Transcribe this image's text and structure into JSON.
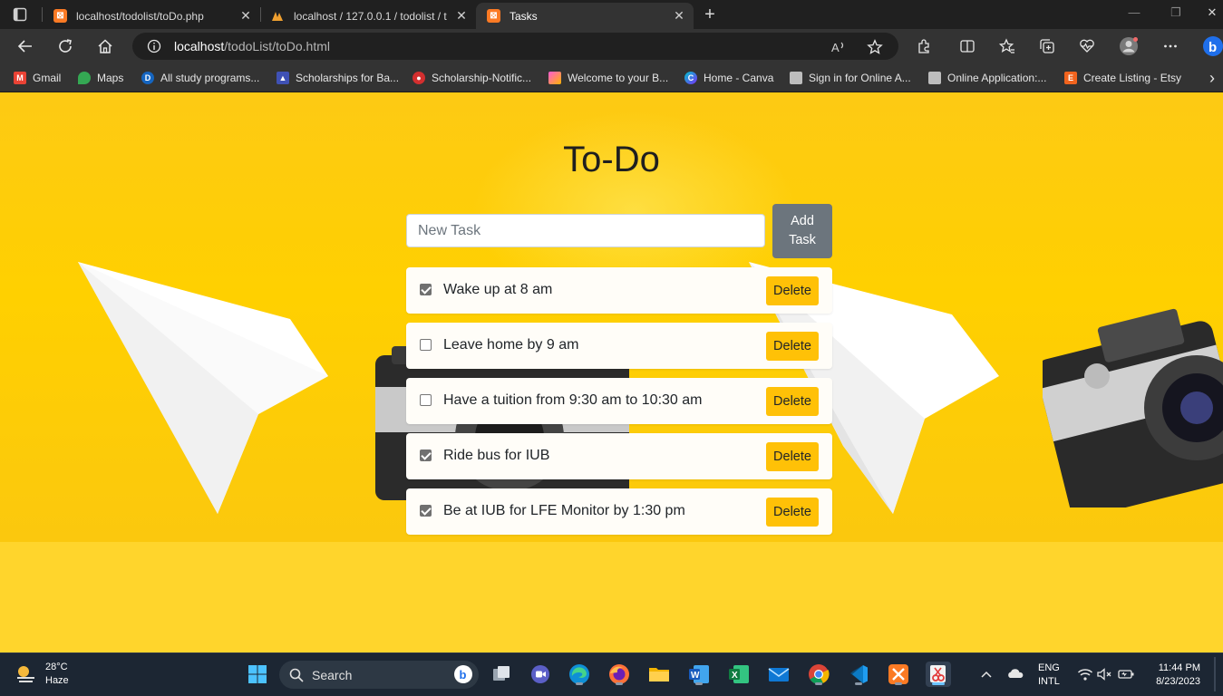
{
  "browser": {
    "tabs": [
      {
        "title": "localhost/todolist/toDo.php",
        "active": false,
        "icon": "xampp-icon"
      },
      {
        "title": "localhost / 127.0.0.1 / todolist / t",
        "active": false,
        "icon": "phpmyadmin-icon"
      },
      {
        "title": "Tasks",
        "active": true,
        "icon": "xampp-icon"
      }
    ],
    "tab_close_glyph": "✕",
    "new_tab_glyph": "+",
    "window_controls": {
      "minimize": "—",
      "maximize": "❐",
      "close": "✕"
    },
    "address": {
      "host": "localhost",
      "path": "/todoList/toDo.html"
    },
    "bookmarks": [
      {
        "label": "Gmail",
        "icon": "gmail-icon",
        "color": "#ea4335"
      },
      {
        "label": "Maps",
        "icon": "maps-icon",
        "color": "#34a853"
      },
      {
        "label": "All study programs...",
        "icon": "d-icon",
        "color": "#1565c0"
      },
      {
        "label": "Scholarships for Ba...",
        "icon": "scholarship-icon",
        "color": "#3f51b5"
      },
      {
        "label": "Scholarship-Notific...",
        "icon": "notification-icon",
        "color": "#d32f2f"
      },
      {
        "label": "Welcome to your B...",
        "icon": "welcome-icon",
        "color": "#e040fb"
      },
      {
        "label": "Home - Canva",
        "icon": "canva-icon",
        "color": "#7b2ff7"
      },
      {
        "label": "Sign in for Online A...",
        "icon": "page-icon",
        "color": "#9e9e9e"
      },
      {
        "label": "Online Application:...",
        "icon": "page-icon",
        "color": "#9e9e9e"
      },
      {
        "label": "Create Listing - Etsy",
        "icon": "etsy-icon",
        "color": "#f1641e"
      }
    ],
    "bookmarks_more_glyph": "›"
  },
  "app": {
    "title": "To-Do",
    "new_task_placeholder": "New Task",
    "new_task_value": "",
    "add_button_label": "Add Task",
    "delete_label": "Delete",
    "tasks": [
      {
        "text": "Wake up at 8 am",
        "done": true
      },
      {
        "text": "Leave home by 9 am",
        "done": false
      },
      {
        "text": "Have a tuition from 9:30 am to 10:30 am",
        "done": false
      },
      {
        "text": "Ride bus for IUB",
        "done": true
      },
      {
        "text": "Be at IUB for LFE Monitor by 1:30 pm",
        "done": true
      }
    ]
  },
  "taskbar": {
    "weather": {
      "temp": "28°C",
      "condition": "Haze"
    },
    "search_label": "Search",
    "apps": [
      "start-icon",
      "search-icon",
      "task-view-icon",
      "chat-icon",
      "edge-icon",
      "firefox-icon",
      "file-explorer-icon",
      "word-icon",
      "excel-icon",
      "mail-icon",
      "chrome-icon",
      "vscode-icon",
      "xampp-icon",
      "snipping-tool-icon"
    ],
    "tray": {
      "lang": "ENG",
      "layout": "INTL",
      "time": "11:44 PM",
      "date": "8/23/2023"
    }
  },
  "colors": {
    "page_bg": "#ffd52a",
    "add_button": "#6c757d",
    "delete_button": "#ffc107",
    "task_card": "#fffdf8"
  }
}
